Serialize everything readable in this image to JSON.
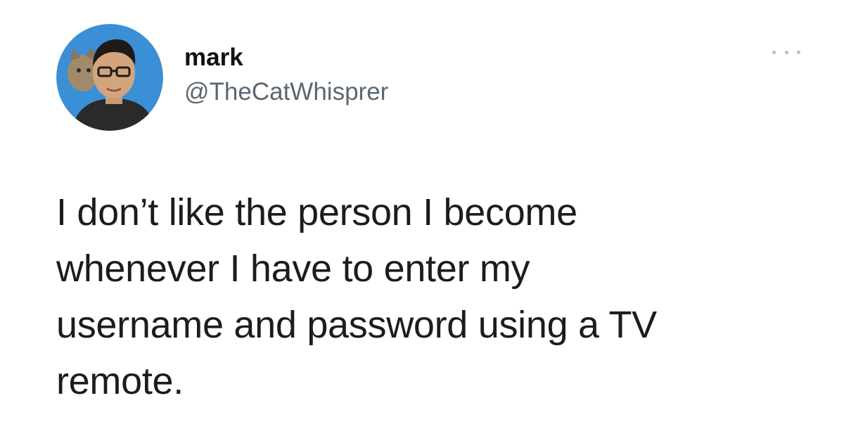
{
  "user": {
    "display_name": "mark",
    "handle": "@TheCatWhisprer",
    "avatar_icon": "profile-photo-man-with-cat",
    "avatar_bg": "#3b8fd6"
  },
  "menu": {
    "icon": "more-options-icon"
  },
  "tweet": {
    "lines": [
      "I don’t like the person I become",
      "whenever I have to enter my",
      "username and password using a TV",
      "remote."
    ]
  }
}
